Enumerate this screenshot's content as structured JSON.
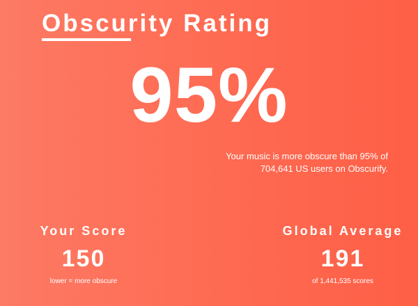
{
  "header": {
    "title": "Obscurity Rating"
  },
  "rating": {
    "percent_text": "95%",
    "description_line1": "Your music is more obscure than 95% of",
    "description_line2": "704,641 US users on Obscurify."
  },
  "stats": {
    "your_score": {
      "label": "Your Score",
      "value": "150",
      "note": "lower = more obscure"
    },
    "global_average": {
      "label": "Global Average",
      "value": "191",
      "note": "of 1,441,535 scores"
    }
  },
  "colors": {
    "background_start": "#fd7a64",
    "background_end": "#fe5f46",
    "text": "#ffffff"
  }
}
